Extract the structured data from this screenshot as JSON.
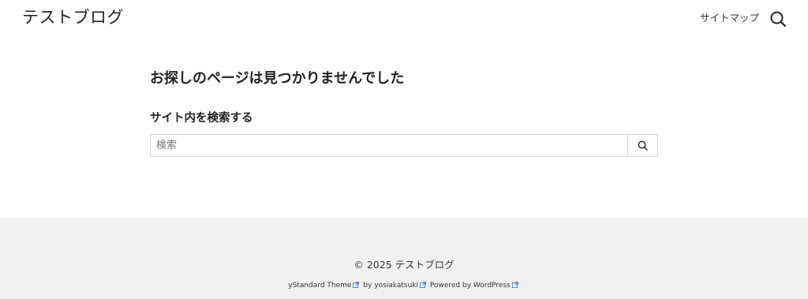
{
  "header": {
    "site_title": "テストブログ",
    "nav_item": "サイトマップ",
    "search_icon": "search-icon"
  },
  "main": {
    "heading": "お探しのページは見つかりませんでした",
    "search_section_title": "サイト内を検索する",
    "search_placeholder": "検索",
    "search_button_icon": "search-icon"
  },
  "footer": {
    "copyright": "© 2025 テストブログ",
    "credits": {
      "theme": "yStandard Theme",
      "by": "by",
      "author": "yosiakatsuki",
      "powered_by": "Powered by WordPress",
      "external_icon": "external-link-icon"
    }
  },
  "colors": {
    "footer_bg": "#f1f1f3",
    "external_link": "#4a90d9",
    "text": "#222222",
    "border": "#d8d8d8"
  }
}
